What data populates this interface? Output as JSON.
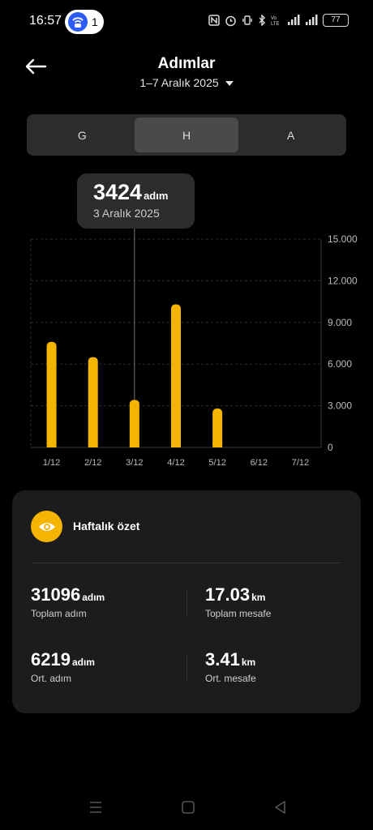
{
  "status_bar": {
    "time": "16:57",
    "notification_count": "1",
    "battery": "77",
    "icons": [
      "nfc-icon",
      "alarm-icon",
      "vibrate-icon",
      "bluetooth-icon",
      "volte-icon",
      "signal-icon",
      "signal-icon"
    ]
  },
  "header": {
    "back_icon": "arrow-left-icon",
    "title": "Adımlar",
    "date_range": "1–7 Aralık 2025"
  },
  "tabs": [
    {
      "label": "G",
      "active": false
    },
    {
      "label": "H",
      "active": true
    },
    {
      "label": "A",
      "active": false
    }
  ],
  "tooltip": {
    "value": "3424",
    "unit": "adım",
    "date": "3 Aralık 2025"
  },
  "chart_data": {
    "type": "bar",
    "categories": [
      "1/12",
      "2/12",
      "3/12",
      "4/12",
      "5/12",
      "6/12",
      "7/12"
    ],
    "values": [
      7600,
      6500,
      3424,
      10300,
      2800,
      0,
      0
    ],
    "yticks": [
      "0",
      "3.000",
      "6.000",
      "9.000",
      "12.000",
      "15.000"
    ],
    "ylim": [
      0,
      15000
    ],
    "selected_index": 2,
    "bar_color": "#f5b400",
    "grid": true
  },
  "summary": {
    "icon": "eye-icon",
    "title": "Haftalık özet",
    "stats": [
      {
        "value": "31096",
        "unit": "adım",
        "label": "Toplam adım"
      },
      {
        "value": "17.03",
        "unit": "km",
        "label": "Toplam mesafe"
      },
      {
        "value": "6219",
        "unit": "adım",
        "label": "Ort. adım"
      },
      {
        "value": "3.41",
        "unit": "km",
        "label": "Ort. mesafe"
      }
    ]
  },
  "navbar": {
    "icons": [
      "menu-icon",
      "home-square-icon",
      "back-triangle-icon"
    ]
  },
  "colors": {
    "accent": "#f5b400",
    "background": "#000000",
    "card": "#1c1c1e"
  }
}
